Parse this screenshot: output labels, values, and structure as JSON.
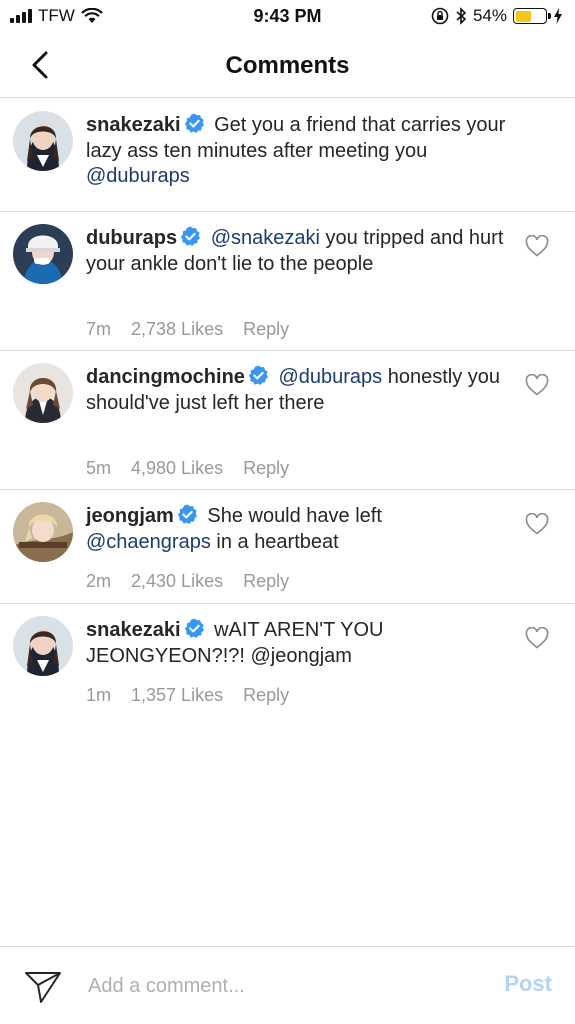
{
  "status_bar": {
    "carrier": "TFW",
    "time": "9:43 PM",
    "battery_percent": "54%",
    "battery_level": 0.54,
    "battery_color": "#f5c518"
  },
  "header": {
    "title": "Comments",
    "back_icon": "chevron-left-icon"
  },
  "colors": {
    "mention": "#1a3d6e",
    "verified_badge": "#3897f0",
    "meta_text": "#999999",
    "post_disabled": "#b3d4f5"
  },
  "comments": [
    {
      "username": "snakezaki",
      "verified": true,
      "parts": [
        " Get you a friend that carries your lazy ass ten minutes after meeting you ",
        "@duburaps"
      ],
      "caption": true
    },
    {
      "username": "duburaps",
      "verified": true,
      "parts": [
        " ",
        "@snakezaki",
        " you tripped and hurt your ankle don't lie to the people"
      ],
      "time": "7m",
      "likes": "2,738 Likes",
      "reply": "Reply"
    },
    {
      "username": "dancingmochine",
      "verified": true,
      "parts": [
        " ",
        "@duburaps",
        " honestly you should've just left her there"
      ],
      "time": "5m",
      "likes": "4,980 Likes",
      "reply": "Reply"
    },
    {
      "username": "jeongjam",
      "verified": true,
      "parts": [
        " She would have left ",
        "@chaengraps",
        " in a heartbeat"
      ],
      "time": "2m",
      "likes": "2,430 Likes",
      "reply": "Reply"
    },
    {
      "username": "snakezaki",
      "verified": true,
      "parts": [
        " wAIT AREN'T YOU JEONGYEON?!?! @jeongjam"
      ],
      "time": "1m",
      "likes": "1,357 Likes",
      "reply": "Reply"
    }
  ],
  "composer": {
    "placeholder": "Add a comment...",
    "post_label": "Post",
    "send_icon": "paper-plane-icon"
  }
}
